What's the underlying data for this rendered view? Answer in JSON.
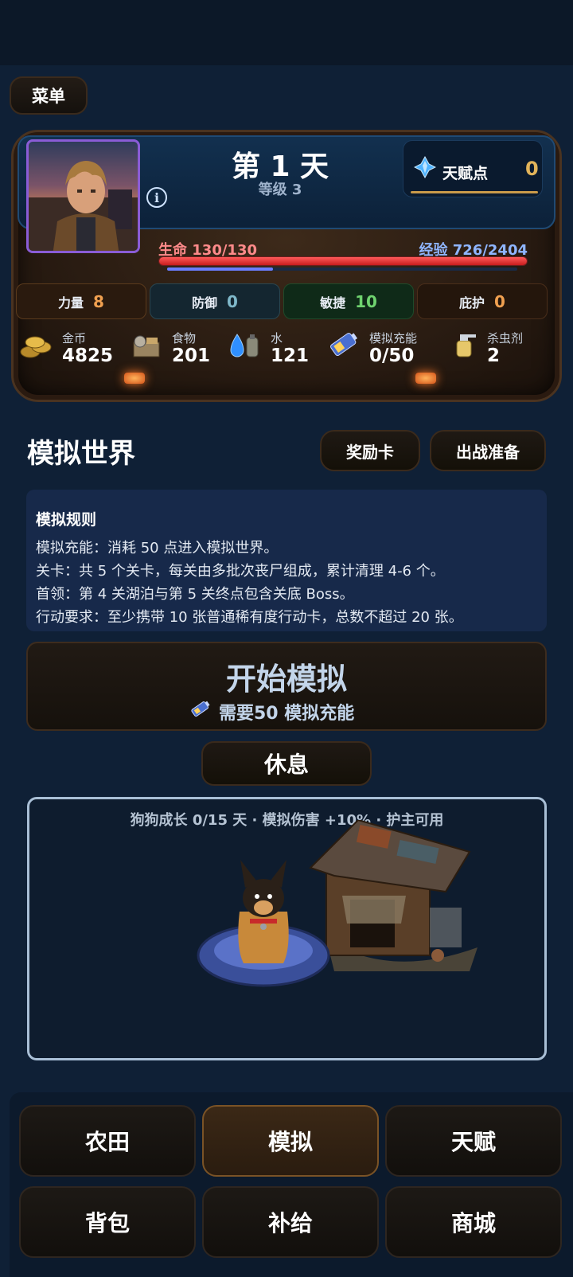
{
  "header": {
    "menu_label": "菜单"
  },
  "hud": {
    "day_title": "第 1 天",
    "level": "等级 3",
    "talent": {
      "label": "天赋点",
      "value": "0"
    },
    "hp_label": "生命 130/130",
    "hp_fraction": 1.0,
    "xp_label": "经验 726/2404",
    "xp_fraction": 0.302,
    "stats": [
      {
        "label": "力量",
        "value": "8",
        "color": "#f0a050",
        "border": "#5a3a1c",
        "bg": "#2a1a0e"
      },
      {
        "label": "防御",
        "value": "0",
        "color": "#7fb8c9",
        "border": "#2a4650",
        "bg": "#142630"
      },
      {
        "label": "敏捷",
        "value": "10",
        "color": "#6fd36f",
        "border": "#1f4a2a",
        "bg": "#0f2a18"
      },
      {
        "label": "庇护",
        "value": "0",
        "color": "#f0a050",
        "border": "#4a2e1a",
        "bg": "#24160c"
      }
    ],
    "resources": [
      {
        "label": "金币",
        "value": "4825",
        "icon": "coins-icon"
      },
      {
        "label": "食物",
        "value": "201",
        "icon": "food-crate-icon"
      },
      {
        "label": "水",
        "value": "121",
        "icon": "water-drop-icon"
      },
      {
        "label": "模拟充能",
        "value": "0/50",
        "icon": "battery-icon"
      },
      {
        "label": "杀虫剂",
        "value": "2",
        "icon": "spray-bottle-icon"
      }
    ]
  },
  "simulation": {
    "title": "模拟世界",
    "reward_card_label": "奖励卡",
    "battle_prep_label": "出战准备",
    "rules_title": "模拟规则",
    "rules": [
      "模拟充能：消耗 50 点进入模拟世界。",
      "关卡：共 5 个关卡，每关由多批次丧尸组成，累计清理 4-6 个。",
      "首领：第 4 关湖泊与第 5 关终点包含关底 Boss。",
      "行动要求：至少携带 10 张普通稀有度行动卡，总数不超过 20 张。"
    ],
    "start_title": "开始模拟",
    "start_sub": "需要50 模拟充能",
    "rest_label": "休息"
  },
  "dog": {
    "status": "狗狗成长 0/15 天 · 模拟伤害 +10% · 护主可用"
  },
  "nav": {
    "items": [
      "农田",
      "模拟",
      "天赋",
      "背包",
      "补给",
      "商城"
    ],
    "active": "模拟"
  }
}
